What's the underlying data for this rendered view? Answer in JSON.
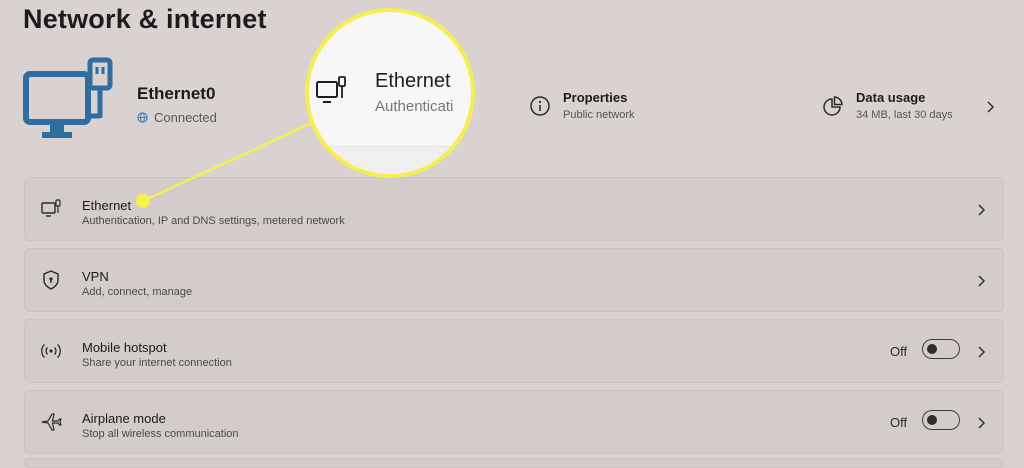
{
  "page_title": "Network & internet",
  "device": {
    "name": "Ethernet0",
    "status": "Connected"
  },
  "properties": {
    "title": "Properties",
    "subtitle": "Public network"
  },
  "data_usage": {
    "title": "Data usage",
    "subtitle": "34 MB, last 30 days"
  },
  "magnifier": {
    "title": "Ethernet",
    "subtitle": "Authenticati"
  },
  "items": [
    {
      "label": "Ethernet",
      "description": "Authentication, IP and DNS settings, metered network",
      "icon": "ethernet-icon"
    },
    {
      "label": "VPN",
      "description": "Add, connect, manage",
      "icon": "shield-icon"
    },
    {
      "label": "Mobile hotspot",
      "description": "Share your internet connection",
      "icon": "hotspot-icon",
      "toggle_label": "Off",
      "toggle_on": false
    },
    {
      "label": "Airplane mode",
      "description": "Stop all wireless communication",
      "icon": "airplane-icon",
      "toggle_label": "Off",
      "toggle_on": false
    }
  ],
  "colors": {
    "accent_yellow": "#f6ee51",
    "monitor_blue": "#2f6ea0",
    "background": "#d9d2d1"
  }
}
